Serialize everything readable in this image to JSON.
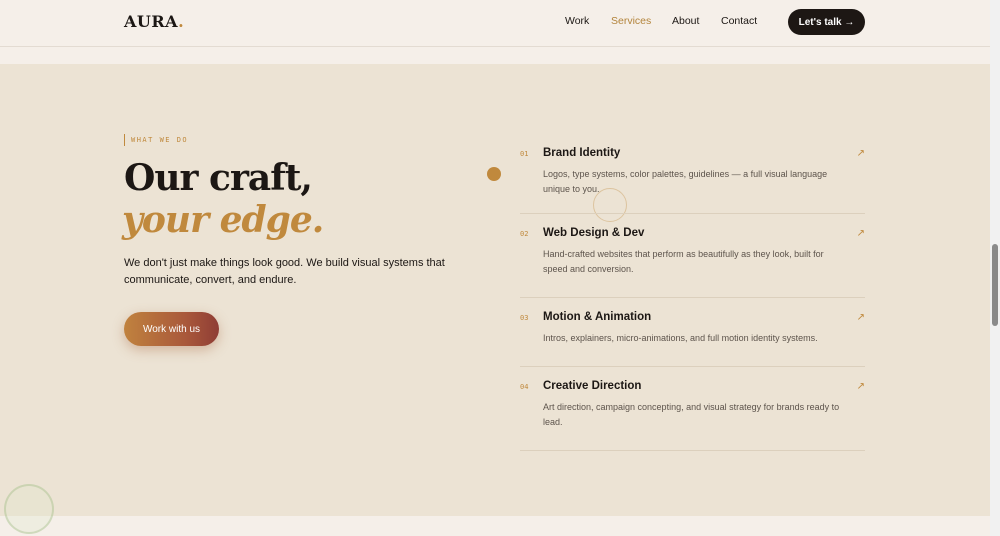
{
  "nav": {
    "logo": "AURA",
    "logo_dot": ".",
    "links": [
      "Work",
      "Services",
      "About",
      "Contact"
    ],
    "active": "Services",
    "cta": "Let's talk →"
  },
  "hero": {
    "eyebrow": "WHAT WE DO",
    "heading_line1": "Our craft,",
    "heading_line2": "your edge.",
    "intro": "We don't just make things look good. We build visual systems that communicate, convert, and endure.",
    "button": "Work with us"
  },
  "services": [
    {
      "num": "01",
      "title": "Brand Identity",
      "desc": "Logos, type systems, color palettes, guidelines — a full visual language unique to you.",
      "arrow": "↗"
    },
    {
      "num": "02",
      "title": "Web Design & Dev",
      "desc": "Hand-crafted websites that perform as beautifully as they look, built for speed and conversion.",
      "arrow": "↗"
    },
    {
      "num": "03",
      "title": "Motion & Animation",
      "desc": "Intros, explainers, micro-animations, and full motion identity systems.",
      "arrow": "↗"
    },
    {
      "num": "04",
      "title": "Creative Direction",
      "desc": "Art direction, campaign concepting, and visual strategy for brands ready to lead.",
      "arrow": "↗"
    }
  ],
  "colors": {
    "accent": "#c0893d",
    "dark": "#1d1714",
    "section_bg": "#ece3d4",
    "page_bg": "#f5efe9"
  },
  "icons": {
    "arrow": "arrow-up-right-icon"
  }
}
